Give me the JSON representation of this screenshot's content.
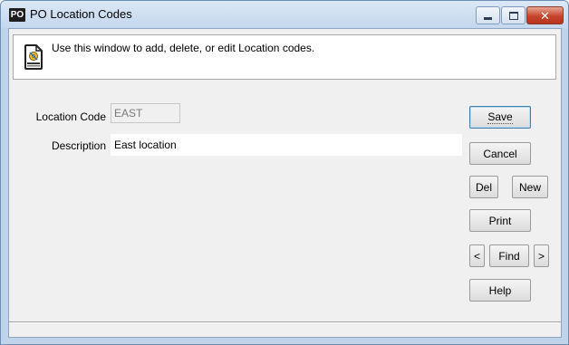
{
  "window": {
    "app_icon": "PO",
    "title": "PO Location Codes"
  },
  "info": {
    "icon": "document-gear-icon",
    "text": "Use this window to add, delete, or edit Location codes."
  },
  "form": {
    "location_code_label": "Location Code",
    "location_code_value": "EAST",
    "description_label": "Description",
    "description_value": "East location"
  },
  "buttons": {
    "save": "Save",
    "cancel": "Cancel",
    "del": "Del",
    "new": "New",
    "print": "Print",
    "prev": "<",
    "find": "Find",
    "next": ">",
    "help": "Help"
  }
}
